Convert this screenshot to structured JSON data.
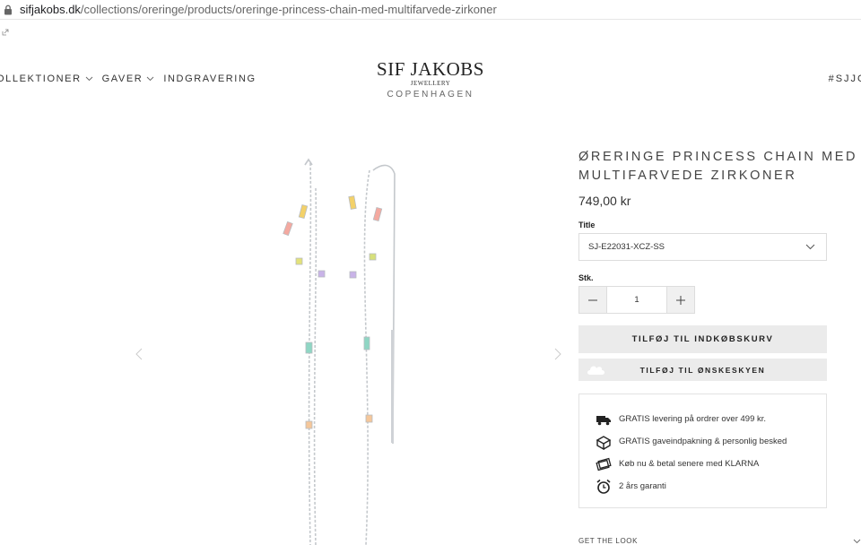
{
  "browser": {
    "url_domain": "sifjakobs.dk",
    "url_path": "/collections/oreringe/products/oreringe-princess-chain-med-multifarvede-zirkoner"
  },
  "nav": {
    "items": [
      {
        "label": "OLLEKTIONER",
        "dropdown": true
      },
      {
        "label": "GAVER",
        "dropdown": true
      },
      {
        "label": "INDGRAVERING",
        "dropdown": false
      }
    ],
    "hashtag": "#SJJC"
  },
  "logo": {
    "brand": "SIF JAKOBS",
    "sub": "JEWELLERY",
    "city": "COPENHAGEN"
  },
  "product": {
    "title_line1": "ØRERINGE PRINCESS CHAIN MED",
    "title_line2": "MULTIFARVEDE ZIRKONER",
    "price": "749,00 kr",
    "variant_label": "Title",
    "variant_value": "SJ-E22031-XCZ-SS",
    "qty_label": "Stk.",
    "qty_value": "1",
    "add_to_cart": "TILFØJ TIL INDKØBSKURV",
    "add_to_wishlist": "TILFØJ TIL ØNSKESKYEN"
  },
  "perks": [
    {
      "icon": "truck-icon",
      "text": "GRATIS levering på ordrer over 499 kr."
    },
    {
      "icon": "gift-box-icon",
      "text": "GRATIS gaveindpakning & personlig besked"
    },
    {
      "icon": "cards-icon",
      "text": "Køb nu & betal senere med KLARNA"
    },
    {
      "icon": "alarm-clock-icon",
      "text": "2 års garanti"
    }
  ],
  "get_the_look": "GET THE LOOK",
  "colors": {
    "button_bg": "#ebebeb",
    "border": "#dddddd",
    "text": "#333333",
    "chain": "#c4c8cc"
  },
  "gems": [
    {
      "color": "#f3d169"
    },
    {
      "color": "#f4a9a0"
    },
    {
      "color": "#e3e27a"
    },
    {
      "color": "#c9b3e8"
    },
    {
      "color": "#8fd6c4"
    },
    {
      "color": "#f5c79a"
    },
    {
      "color": "#f3d169"
    },
    {
      "color": "#f4a9a0"
    },
    {
      "color": "#d7e07a"
    },
    {
      "color": "#c9b3e8"
    },
    {
      "color": "#8fd6c4"
    },
    {
      "color": "#f5c79a"
    }
  ]
}
